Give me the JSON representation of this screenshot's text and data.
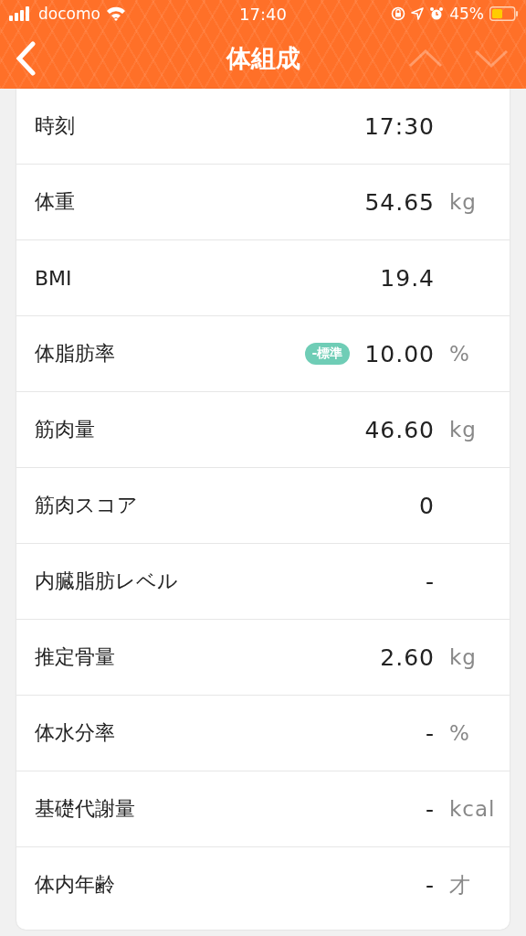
{
  "status_bar": {
    "carrier": "docomo",
    "time": "17:40",
    "battery": "45%"
  },
  "nav": {
    "title": "体組成",
    "up": {
      "disabled": true
    },
    "down": {
      "disabled": true
    }
  },
  "rows": [
    {
      "label": "時刻",
      "value": "17:30"
    },
    {
      "label": "体重",
      "value": "54.65",
      "unit": "kg"
    },
    {
      "label": "BMI",
      "value": "19.4"
    },
    {
      "label": "体脂肪率",
      "value": "10.00",
      "unit": "%",
      "badge": {
        "text": "-標準",
        "color": "#6fcdb6"
      }
    },
    {
      "label": "筋肉量",
      "value": "46.60",
      "unit": "kg"
    },
    {
      "label": "筋肉スコア",
      "value": "0"
    },
    {
      "label": "内臓脂肪レベル",
      "value": "-"
    },
    {
      "label": "推定骨量",
      "value": "2.60",
      "unit": "kg"
    },
    {
      "label": "体水分率",
      "value": "-",
      "unit": "%"
    },
    {
      "label": "基礎代謝量",
      "value": "-",
      "unit": "kcal"
    },
    {
      "label": "体内年齢",
      "value": "-",
      "unit": "才"
    }
  ]
}
